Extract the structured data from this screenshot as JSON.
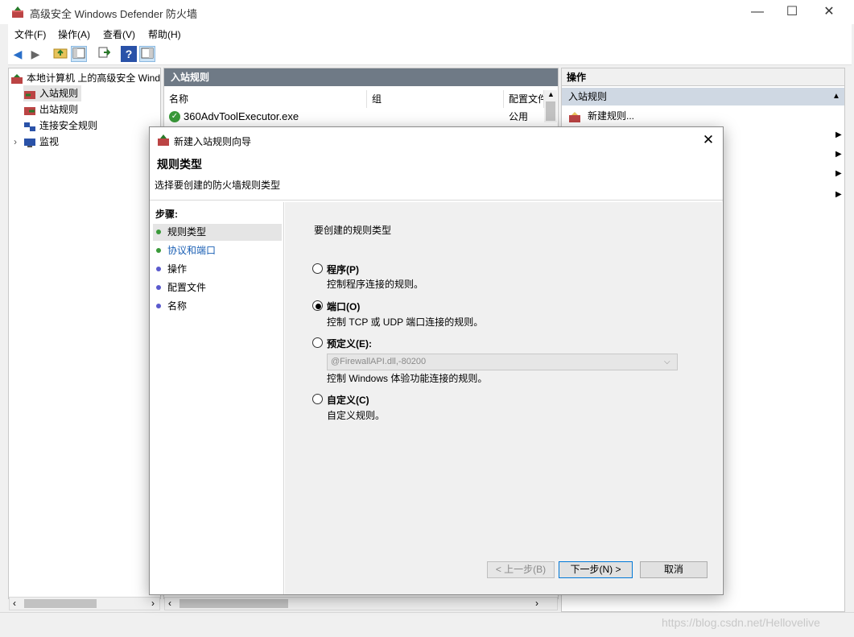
{
  "window": {
    "title": "高级安全 Windows Defender 防火墙",
    "minimize": "—",
    "maximize": "☐",
    "close": "✕"
  },
  "menu": [
    "文件(F)",
    "操作(A)",
    "查看(V)",
    "帮助(H)"
  ],
  "tree": {
    "root": "本地计算机 上的高级安全 Wind",
    "items": [
      "入站规则",
      "出站规则",
      "连接安全规则",
      "监视"
    ]
  },
  "middle": {
    "header": "入站规则",
    "columns": [
      "名称",
      "组",
      "配置文件"
    ],
    "rows": [
      {
        "name": "360AdvToolExecutor.exe",
        "group": "",
        "profile": "公用"
      }
    ]
  },
  "actions": {
    "header": "操作",
    "section": "入站规则",
    "new_rule": "新建规则..."
  },
  "dialog": {
    "title": "新建入站规则向导",
    "heading": "规则类型",
    "subheading": "选择要创建的防火墙规则类型",
    "steps_label": "步骤:",
    "steps": [
      {
        "label": "规则类型",
        "current": true,
        "dot_color": "#3a9a3a"
      },
      {
        "label": "协议和端口",
        "current": false,
        "link": true,
        "dot_color": "#3a9a3a"
      },
      {
        "label": "操作",
        "current": false,
        "dot_color": "#5a5acd"
      },
      {
        "label": "配置文件",
        "current": false,
        "dot_color": "#5a5acd"
      },
      {
        "label": "名称",
        "current": false,
        "dot_color": "#5a5acd"
      }
    ],
    "question": "要创建的规则类型",
    "options": [
      {
        "label": "程序(P)",
        "desc": "控制程序连接的规则。",
        "selected": false
      },
      {
        "label": "端口(O)",
        "desc": "控制 TCP 或 UDP 端口连接的规则。",
        "selected": true
      },
      {
        "label": "预定义(E):",
        "desc": "控制 Windows 体验功能连接的规则。",
        "selected": false
      },
      {
        "label": "自定义(C)",
        "desc": "自定义规则。",
        "selected": false
      }
    ],
    "predefined_select": "@FirewallAPI.dll,-80200",
    "buttons": {
      "back": "< 上一步(B)",
      "next": "下一步(N) >",
      "cancel": "取消"
    },
    "close": "✕"
  },
  "watermark": "https://blog.csdn.net/Hellovelive"
}
